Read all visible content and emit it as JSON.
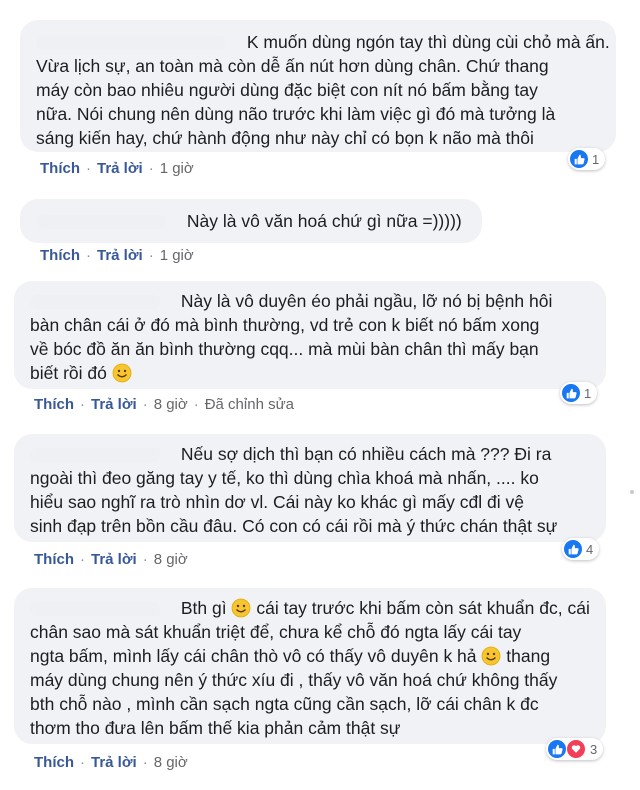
{
  "actions": {
    "like": "Thích",
    "reply": "Trả lời",
    "edited": "Đã chỉnh sửa"
  },
  "colors": {
    "bubble": "#f0f2f5",
    "link": "#385898",
    "meta": "#65676b",
    "like": "#1877f2",
    "love": "#f33e58"
  },
  "comments": [
    {
      "lines": [
        "K muốn dùng ngón tay thì dùng cùi chỏ mà ấn.",
        "Vừa lịch sự, an toàn mà còn dễ ấn nút hơn dùng chân. Chứ thang",
        "máy còn bao nhiêu người dùng đặc biệt con nít nó bấm bằng tay",
        "nữa. Nói chung nên dùng não trước khi làm việc gì đó mà tưởng là",
        "sáng kiến hay, chứ hành động như này chỉ có bọn k não mà thôi"
      ],
      "time": "1 giờ",
      "reaction_count": "1",
      "reaction_icons": [
        "like-icon"
      ]
    },
    {
      "lines": [
        "Này là vô văn hoá chứ gì nữa =)))))"
      ],
      "time": "1 giờ",
      "reaction_count": "",
      "reaction_icons": []
    },
    {
      "lines": [
        "Này là vô duyên éo phải ngầu, lỡ nó bị bệnh hôi",
        "bàn chân cái ở đó mà bình thường, vd trẻ con k biết nó bấm xong",
        "về bóc đồ ăn ăn bình thường cqq... mà mùi bàn chân thì mấy bạn",
        "biết rồi đó"
      ],
      "time": "8 giờ",
      "edited": true,
      "reaction_count": "1",
      "reaction_icons": [
        "like-icon"
      ]
    },
    {
      "lines": [
        "Nếu sợ dịch thì bạn có nhiều cách mà ??? Đi ra",
        "ngoài thì đeo găng tay y tế, ko thì dùng chìa khoá mà nhấn, .... ko",
        "hiểu sao nghĩ ra trò nhìn dơ vl. Cái này ko khác gì mấy cđl đi vệ",
        "sinh đạp trên bồn cầu đâu. Có con có cái rồi mà ý thức chán thật sự"
      ],
      "time": "8 giờ",
      "reaction_count": "4",
      "reaction_icons": [
        "like-icon"
      ]
    },
    {
      "lines": [
        "Bth gì",
        "cái tay trước khi bấm còn sát khuẩn đc, cái",
        "chân sao mà sát khuẩn triệt để, chưa kể chỗ đó ngta lấy cái tay",
        "ngta bấm, mình lấy cái chân thò vô có thấy vô duyên k hả",
        "thang",
        "máy dùng chung nên ý thức xíu đi , thấy vô văn hoá chứ không thấy",
        "bth chỗ nào , mình cần sạch ngta cũng cần sạch, lỡ cái chân k đc",
        "thơm tho đưa lên bấm thế kia phản cảm thật sự"
      ],
      "time": "8 giờ",
      "reaction_count": "3",
      "reaction_icons": [
        "like-icon",
        "heart-icon"
      ]
    }
  ]
}
